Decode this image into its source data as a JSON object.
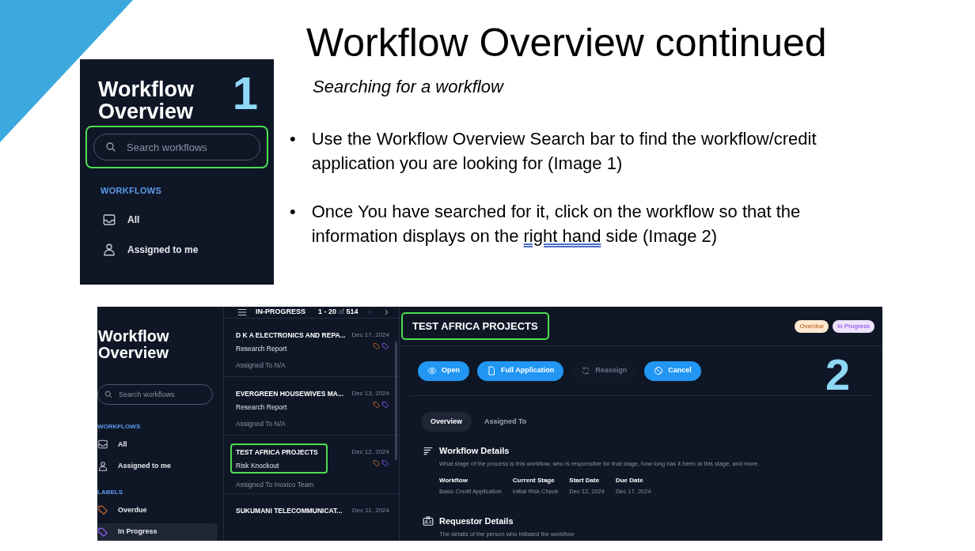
{
  "slide": {
    "title": "Workflow Overview continued",
    "subtitle": "Searching for a workflow",
    "bullets": [
      {
        "mark": "•",
        "segments": [
          {
            "text": "Use the Workflow Overview Search bar to find the workflow/credit application you are looking for (Image 1)",
            "underlined": false
          }
        ]
      },
      {
        "mark": "•",
        "segments": [
          {
            "text": "Once You have searched for it, click on the workflow so that the information displays on the ",
            "underlined": false
          },
          {
            "text": "right hand",
            "underlined": true
          },
          {
            "text": " side (Image 2)",
            "underlined": false
          }
        ]
      }
    ]
  },
  "image_1": {
    "title": "Workflow Overview",
    "number": "1",
    "search": {
      "placeholder": "Search workflows",
      "highlighted": true
    },
    "section": "WORKFLOWS",
    "items": [
      {
        "label": "All",
        "kind": "inbox"
      },
      {
        "label": "Assigned to me",
        "kind": "person"
      }
    ]
  },
  "image_2": {
    "number": "2",
    "sidebar": {
      "title": "Workflow Overview",
      "search": {
        "placeholder": "Search workflows"
      },
      "sections": [
        {
          "title": "WORKFLOWS",
          "items": [
            {
              "label": "All",
              "kind": "inbox",
              "selected": false
            },
            {
              "label": "Assigned to me",
              "kind": "person",
              "selected": false
            }
          ]
        },
        {
          "title": "LABELS",
          "items": [
            {
              "label": "Overdue",
              "kind": "tag",
              "color": "#c2692a",
              "selected": false
            },
            {
              "label": "In Progress",
              "kind": "tag",
              "color": "#8b5cf6",
              "selected": true
            }
          ]
        }
      ]
    },
    "list": {
      "title": "IN-PROGRESS",
      "range": "1 - 20",
      "of": "of",
      "total": "514",
      "items": [
        {
          "name": "D K A ELECTRONICS AND REPA...",
          "date": "Dec 17, 2024",
          "type": "Research Report",
          "assignee": "Assigned To N/A",
          "highlighted": false
        },
        {
          "name": "EVERGREEN HOUSEWIVES MA...",
          "date": "Dec 13, 2024",
          "type": "Research Report",
          "assignee": "Assigned To N/A",
          "highlighted": false
        },
        {
          "name": "TEST AFRICA PROJECTS",
          "date": "Dec 12, 2024",
          "type": "Risk Knockout",
          "assignee": "Assigned To Inoxico Team",
          "highlighted": true
        },
        {
          "name": "SUKUMANI TELECOMMUNICAT...",
          "date": "Dec 11, 2024",
          "highlighted": false
        }
      ]
    },
    "detail": {
      "title": "TEST AFRICA PROJECTS",
      "highlighted": true,
      "badges": [
        {
          "label": "Overdue",
          "color": "#fde8d0"
        },
        {
          "label": "In Progress",
          "color": "#efe3fb"
        }
      ],
      "actions": [
        {
          "label": "Open",
          "kind": "eye",
          "disabled": false
        },
        {
          "label": "Full Application",
          "kind": "file",
          "disabled": false
        },
        {
          "label": "Reassign",
          "kind": "refresh",
          "disabled": true
        },
        {
          "label": "Cancel",
          "kind": "ban",
          "disabled": false
        }
      ],
      "tabs": [
        {
          "label": "Overview",
          "selected": true
        },
        {
          "label": "Assigned To",
          "selected": false
        }
      ],
      "sections": [
        {
          "title": "Workflow Details",
          "kind": "lines",
          "description": "What stage of the process is this workflow, who is responsible for that stage, how long has it been at this stage, and more.",
          "fields": [
            {
              "label": "Workflow",
              "value": "Basic Credit Application"
            },
            {
              "label": "Current Stage",
              "value": "Initial Risk Check"
            },
            {
              "label": "Start Date",
              "value": "Dec 12, 2024"
            },
            {
              "label": "Due Date",
              "value": "Dec 17, 2024"
            }
          ]
        },
        {
          "title": "Requestor Details",
          "kind": "idcard",
          "description": "The details of the person who initiated the workflow"
        }
      ]
    }
  }
}
